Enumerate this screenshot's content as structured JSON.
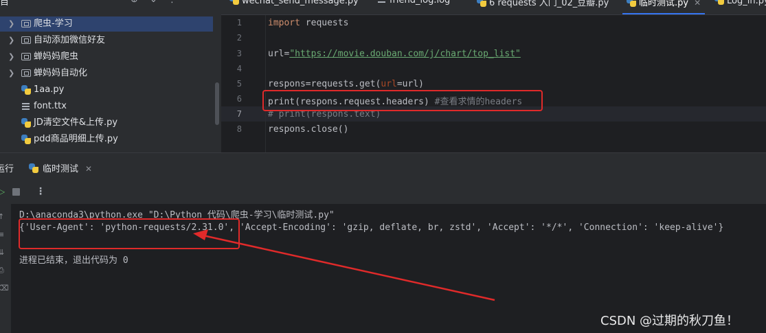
{
  "project": {
    "header_title": "目",
    "items": [
      {
        "label": "爬虫-学习",
        "type": "folder",
        "selected": true
      },
      {
        "label": "自动添加微信好友",
        "type": "folder"
      },
      {
        "label": "蝉妈妈爬虫",
        "type": "folder"
      },
      {
        "label": "蝉妈妈自动化",
        "type": "folder"
      },
      {
        "label": "1aa.py",
        "type": "python"
      },
      {
        "label": "font.ttx",
        "type": "text"
      },
      {
        "label": "JD清空文件&上传.py",
        "type": "python"
      },
      {
        "label": "pdd商品明细上传.py",
        "type": "python"
      }
    ]
  },
  "tabs": [
    {
      "label": "wechat_send_message.py",
      "icon": "python-file-icon"
    },
    {
      "label": "friend_log.log",
      "icon": "log-file-icon"
    },
    {
      "label": "6 requests 入门_02_豆瓣.py",
      "icon": "python-file-icon"
    },
    {
      "label": "临时测试.py",
      "icon": "python-file-icon",
      "active": true
    },
    {
      "label": "Log_in.py",
      "icon": "python-file-icon"
    }
  ],
  "editor": {
    "line_numbers": [
      "1",
      "2",
      "3",
      "4",
      "5",
      "6",
      "7",
      "8"
    ],
    "current_line": "7",
    "lines": {
      "l1_kw": "import",
      "l1_rest": " requests",
      "l3_var": "url=",
      "l3_str": "\"https://movie.douban.com/j/chart/top_list\"",
      "l5_a": "respons=requests.get(",
      "l5_param": "url",
      "l5_b": "=url)",
      "l6_code": "print(respons.request.headers) ",
      "l6_cmt": "#查看求情的headers",
      "l7": "# print(respons.text)",
      "l8": "respons.close()"
    }
  },
  "run": {
    "label": "运行",
    "tab_label": "临时测试",
    "command": "D:\\anaconda3\\python.exe \"D:\\Python 代码\\爬虫-学习\\临时测试.py\"",
    "output": "{'User-Agent': 'python-requests/2.31.0', 'Accept-Encoding': 'gzip, deflate, br, zstd', 'Accept': '*/*', 'Connection': 'keep-alive'}",
    "exit_message": "进程已结束，退出代码为 0"
  },
  "watermark": "CSDN @过期的秋刀鱼！",
  "colors": {
    "accent": "#3574f0",
    "annotation": "#e02a2a",
    "keyword": "#cf8e6d",
    "string": "#6aab73",
    "comment": "#7a7e85"
  }
}
